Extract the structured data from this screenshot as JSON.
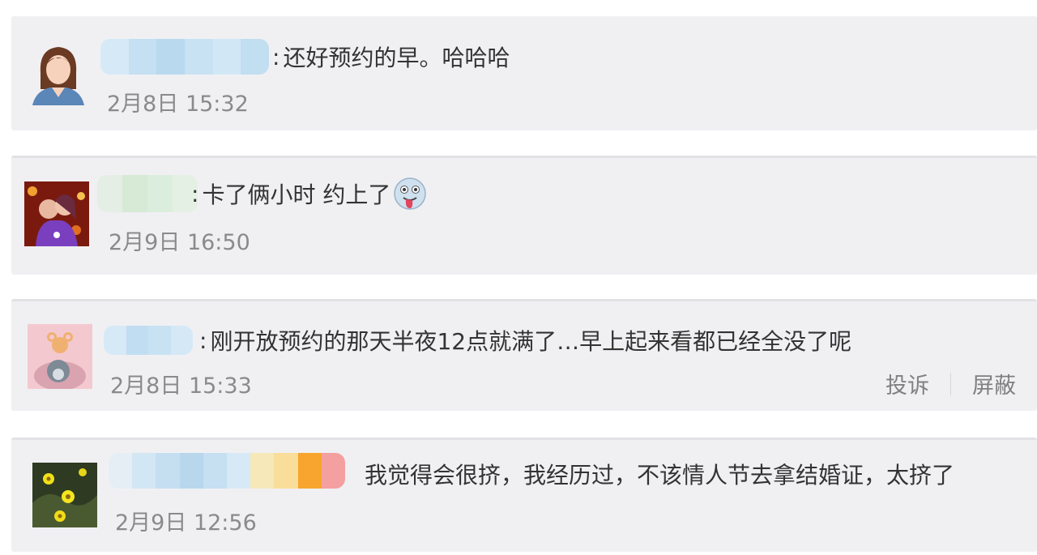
{
  "comments": [
    {
      "colon": ":",
      "text": "还好预约的早。哈哈哈",
      "time": "2月8日 15:32"
    },
    {
      "colon": ":",
      "text": "卡了俩小时 约上了",
      "time": "2月9日 16:50",
      "emoji": "tongue-out-face-icon"
    },
    {
      "colon": ":",
      "text": "刚开放预约的那天半夜12点就满了…早上起来看都已经全没了呢",
      "time": "2月8日 15:33",
      "actions": {
        "report": "投诉",
        "block": "屏蔽"
      }
    },
    {
      "colon": "",
      "text": "我觉得会很挤，我经历过，不该情人节去拿结婚证，太挤了",
      "time": "2月9日 12:56"
    }
  ],
  "colors": {
    "card_bg": "#f0f0f3",
    "text": "#333333",
    "time": "#8a8a8a",
    "blur_blue": "#cfe4f3",
    "blur_green": "#dbeedd"
  }
}
